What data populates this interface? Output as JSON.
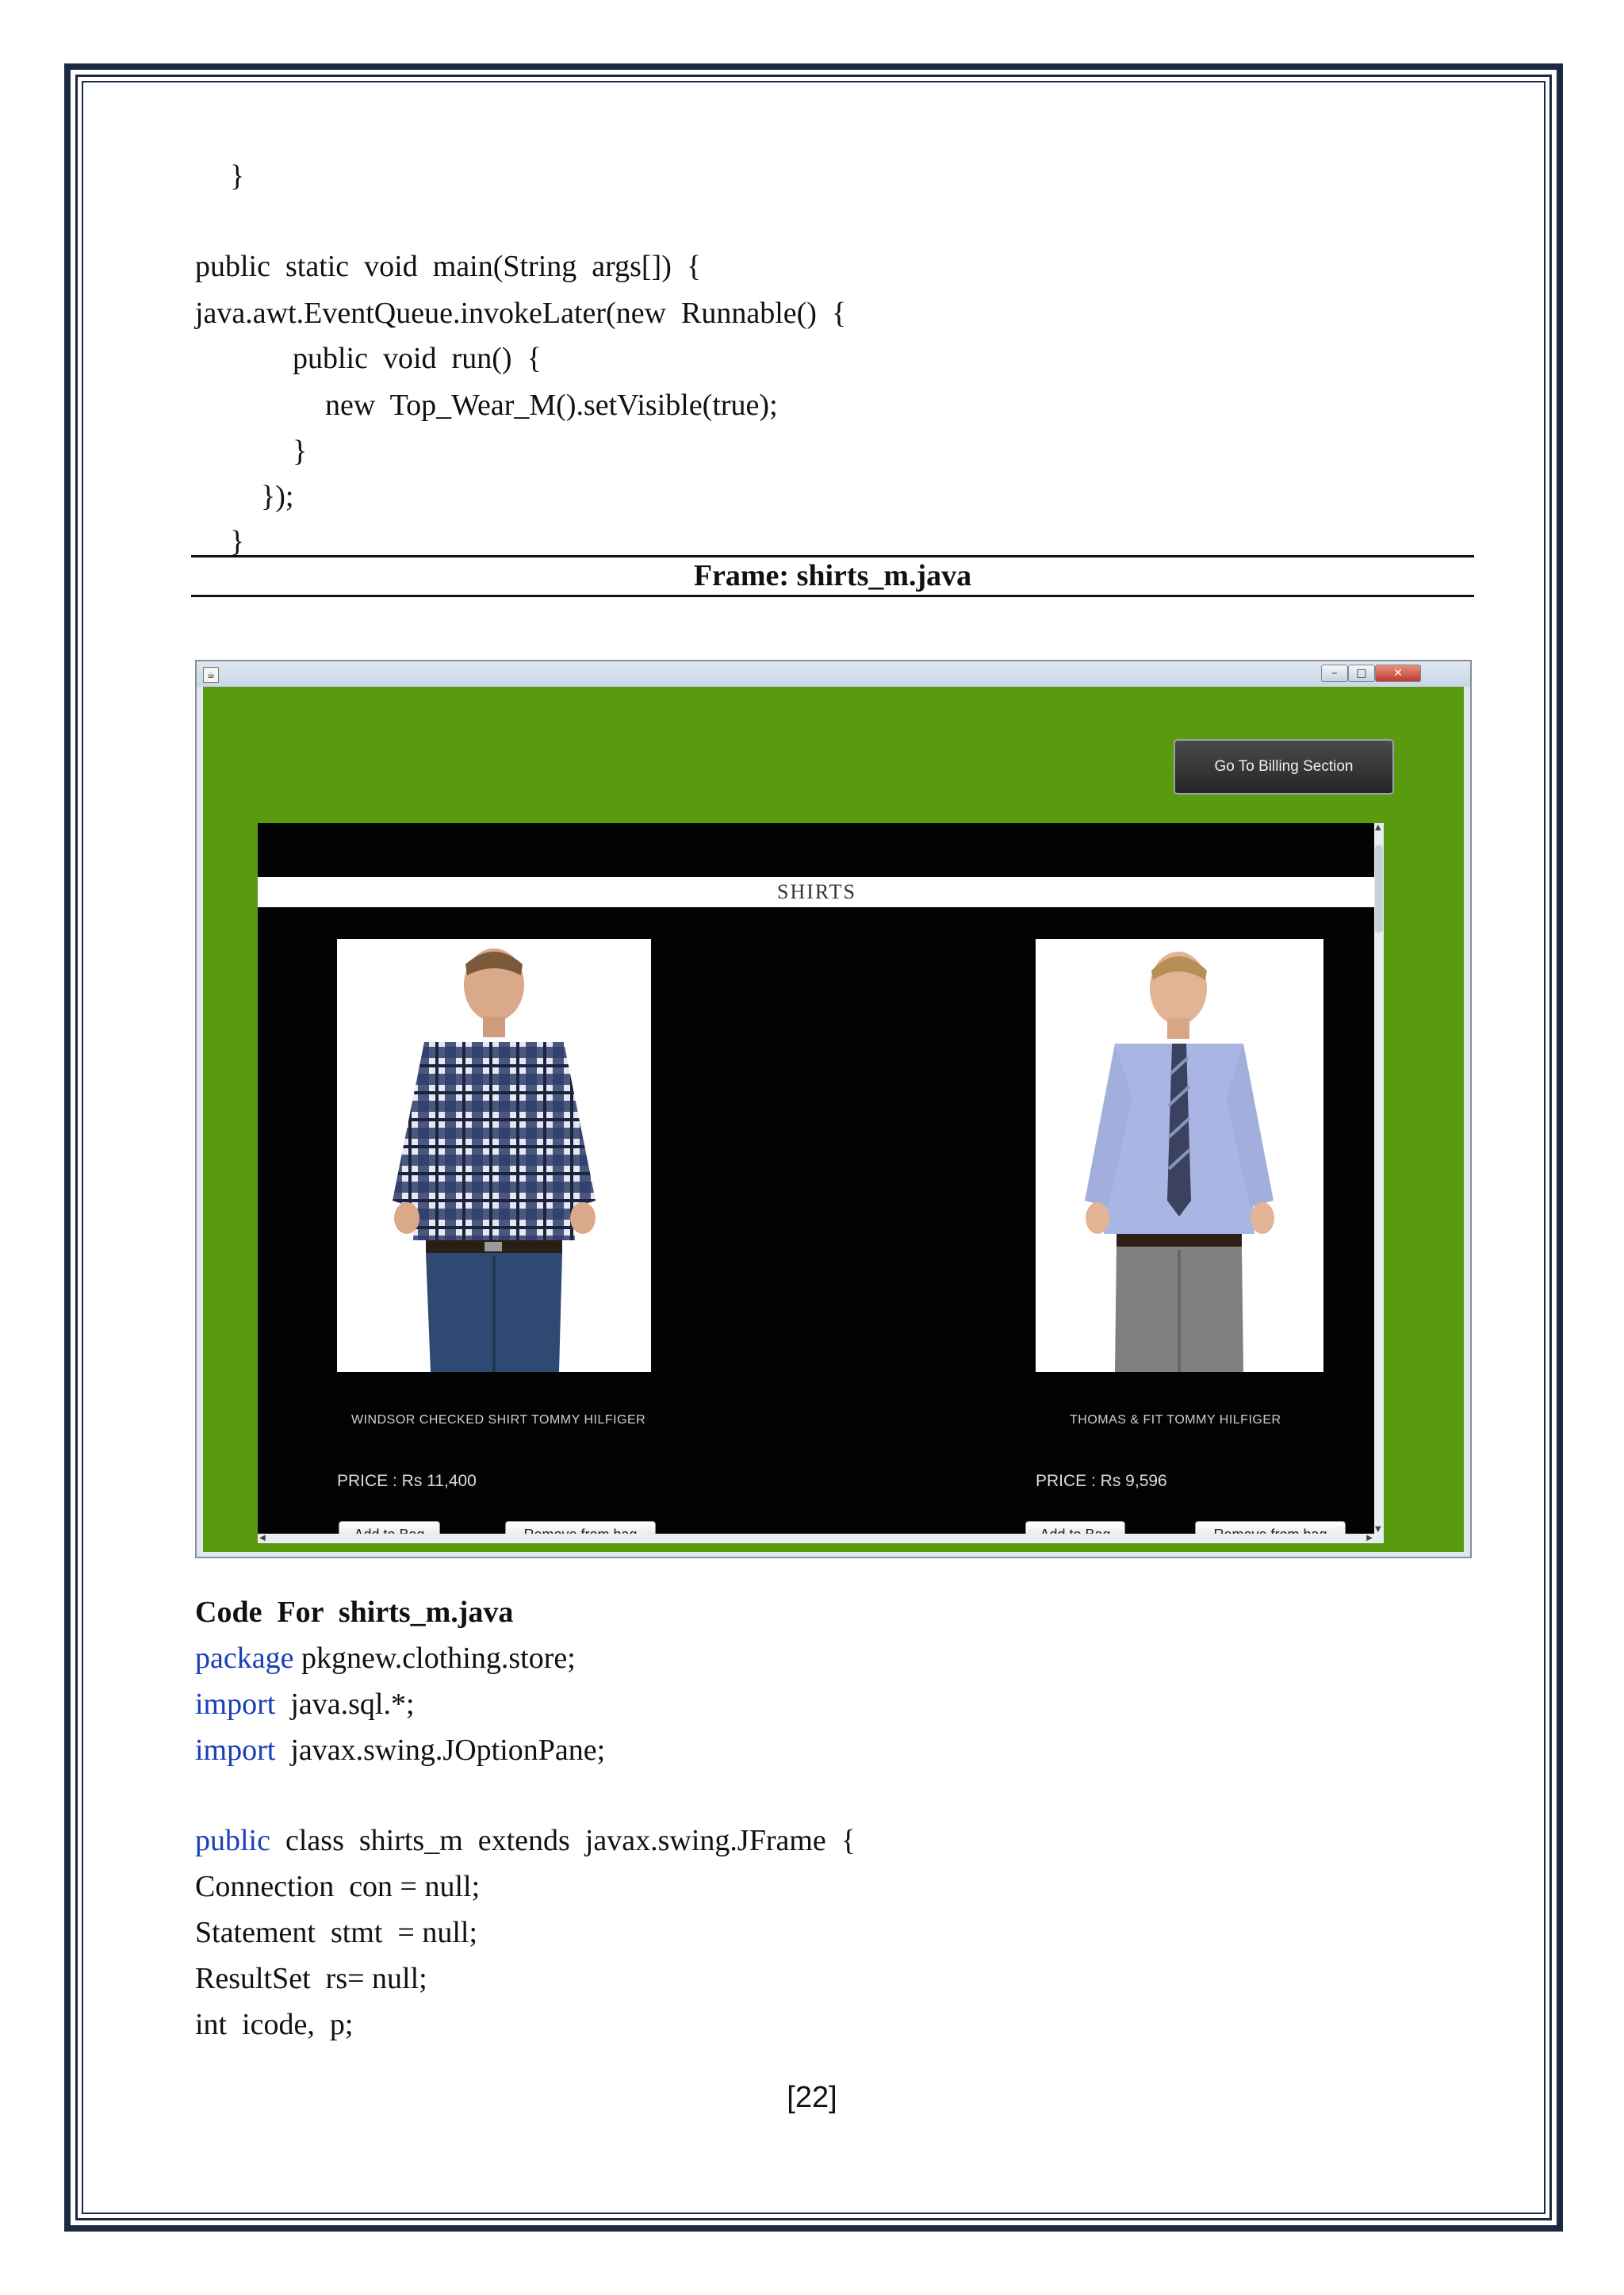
{
  "code_top": [
    "}",
    "public  static  void  main(String  args[])  {",
    "java.awt.EventQueue.invokeLater(new  Runnable()  {",
    "public  void  run()  {",
    "new  Top_Wear_M().setVisible(true);",
    "}",
    "});",
    "}"
  ],
  "frame_caption": "Frame:  shirts_m.java",
  "app": {
    "billing_button": "Go To Billing Section",
    "section_title": "SHIRTS",
    "products": [
      {
        "name": "WINDSOR CHECKED SHIRT    TOMMY HILFIGER",
        "price": "PRICE :  Rs 11,400",
        "add_label": "Add to Bag",
        "remove_label": "Remove from bag"
      },
      {
        "name": "THOMAS & FIT    TOMMY HILFIGER",
        "price": "PRICE : Rs 9,596",
        "add_label": "Add to Bag",
        "remove_label": "Remove from bag"
      }
    ]
  },
  "code_heading": "Code  For  shirts_m.java",
  "code_bottom": {
    "package_kw": "package",
    "package_rest": " pkgnew.clothing.store;",
    "import1_kw": "import",
    "import1_rest": "  java.sql.*;",
    "import2_kw": "import",
    "import2_rest": "  javax.swing.JOptionPane;",
    "class_kw": "public",
    "class_rest": "  class  shirts_m  extends  javax.swing.JFrame  {",
    "line_con": "Connection  con = null;",
    "line_stmt": "Statement  stmt  = null;",
    "line_rs": "ResultSet  rs= null;",
    "line_int": "int  icode,  p;"
  },
  "page_number": "[22]"
}
